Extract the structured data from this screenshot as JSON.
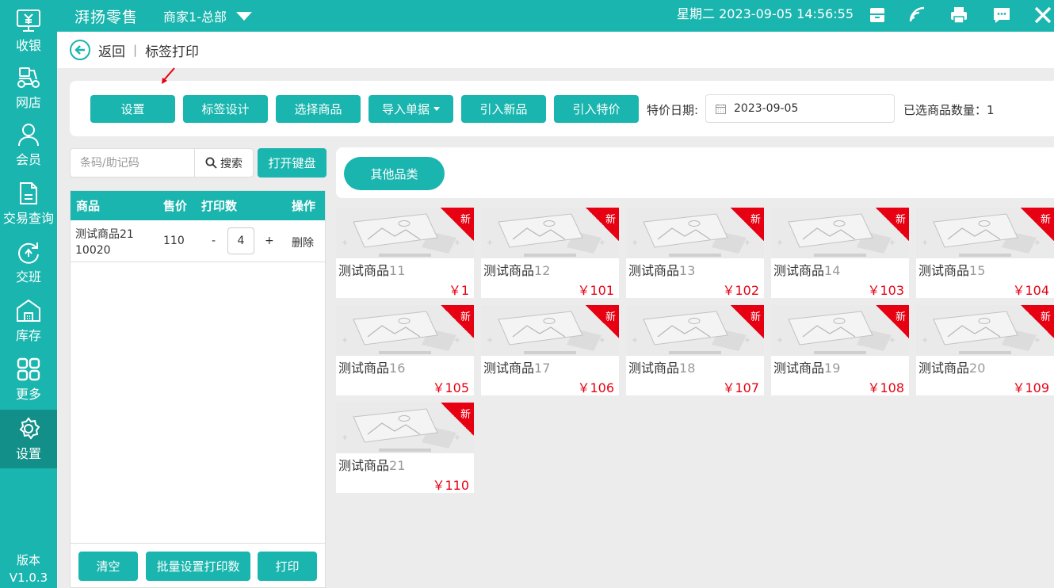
{
  "sidebar": {
    "items": [
      {
        "label": "收银",
        "icon": "cashier-icon"
      },
      {
        "label": "网店",
        "icon": "scooter-icon"
      },
      {
        "label": "会员",
        "icon": "member-icon"
      },
      {
        "label": "交易查询",
        "icon": "document-icon"
      },
      {
        "label": "交班",
        "icon": "handover-icon"
      },
      {
        "label": "库存",
        "icon": "warehouse-icon"
      },
      {
        "label": "更多",
        "icon": "grid-icon"
      },
      {
        "label": "设置",
        "icon": "gear-icon"
      }
    ],
    "version_label": "版本",
    "version": "V1.0.3"
  },
  "topbar": {
    "brand": "湃扬零售",
    "store": "商家1-总部",
    "datetime": "星期二 2023-09-05 14:56:55"
  },
  "subheader": {
    "back": "返回",
    "separator": "|",
    "title": "标签打印"
  },
  "toolbar": {
    "buttons": [
      "设置",
      "标签设计",
      "选择商品",
      "导入单据",
      "引入新品",
      "引入特价"
    ],
    "date_label": "特价日期:",
    "date_value": "2023-09-05",
    "count_label": "已选商品数量：1"
  },
  "search": {
    "placeholder": "条码/助记码",
    "button": "搜索",
    "keyboard": "打开键盘"
  },
  "table": {
    "headers": [
      "商品",
      "售价",
      "打印数",
      "操作"
    ],
    "rows": [
      {
        "name_line1": "测试商品21",
        "name_line2": "10020",
        "price": "110",
        "minus": "-",
        "qty": "4",
        "plus": "+",
        "action": "删除"
      }
    ]
  },
  "bottom": {
    "clear": "清空",
    "batch": "批量设置打印数",
    "print": "打印"
  },
  "category": {
    "label": "其他品类"
  },
  "products": [
    {
      "name": "测试商品",
      "num": "11",
      "price": "￥1",
      "tag": "新"
    },
    {
      "name": "测试商品",
      "num": "12",
      "price": "￥101",
      "tag": "新"
    },
    {
      "name": "测试商品",
      "num": "13",
      "price": "￥102",
      "tag": "新"
    },
    {
      "name": "测试商品",
      "num": "14",
      "price": "￥103",
      "tag": "新"
    },
    {
      "name": "测试商品",
      "num": "15",
      "price": "￥104",
      "tag": "新"
    },
    {
      "name": "测试商品",
      "num": "16",
      "price": "￥105",
      "tag": "新"
    },
    {
      "name": "测试商品",
      "num": "17",
      "price": "￥106",
      "tag": "新"
    },
    {
      "name": "测试商品",
      "num": "18",
      "price": "￥107",
      "tag": "新"
    },
    {
      "name": "测试商品",
      "num": "19",
      "price": "￥108",
      "tag": "新"
    },
    {
      "name": "测试商品",
      "num": "20",
      "price": "￥109",
      "tag": "新"
    },
    {
      "name": "测试商品",
      "num": "21",
      "price": "￥110",
      "tag": "新"
    }
  ],
  "colors": {
    "primary": "#1ab5ae",
    "active": "#118f88",
    "price": "#e60012"
  }
}
